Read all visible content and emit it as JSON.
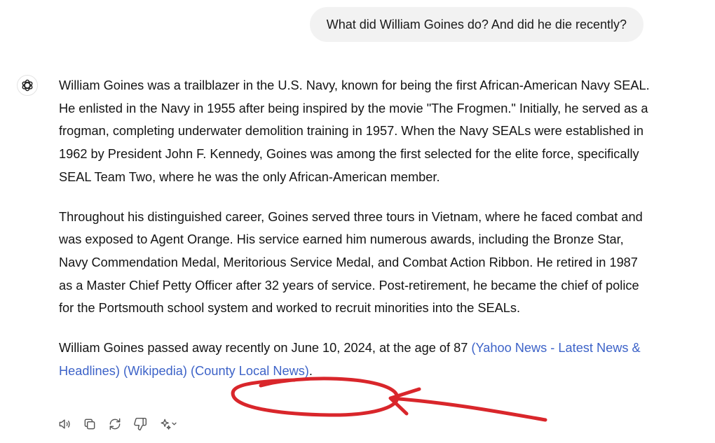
{
  "user_message": {
    "text": "What did William Goines do? And did he die recently?"
  },
  "assistant": {
    "logo_icon": "chatgpt-logo-icon",
    "paragraph1": "William Goines was a trailblazer in the U.S. Navy, known for being the first African-American Navy SEAL. He enlisted in the Navy in 1955 after being inspired by the movie \"The Frogmen.\" Initially, he served as a frogman, completing underwater demolition training in 1957. When the Navy SEALs were established in 1962 by President John F. Kennedy, Goines was among the first selected for the elite force, specifically SEAL Team Two, where he was the only African-American member.",
    "paragraph2": "Throughout his distinguished career, Goines served three tours in Vietnam, where he faced combat and was exposed to Agent Orange. His service earned him numerous awards, including the Bronze Star, Navy Commendation Medal, Meritorious Service Medal, and Combat Action Ribbon. He retired in 1987 as a Master Chief Petty Officer after 32 years of service. Post-retirement, he became the chief of police for the Portsmouth school system and worked to recruit minorities into the SEALs.",
    "paragraph3": {
      "text": "William Goines passed away recently on June 10, 2024, at the age of 87 ",
      "source1": "(Yahoo News - Latest News & Headlines)",
      "source2": "(Wikipedia)",
      "source3": "(County Local News)",
      "end": "."
    }
  },
  "actions": [
    {
      "icon": "read-aloud-icon"
    },
    {
      "icon": "copy-icon"
    },
    {
      "icon": "regenerate-icon"
    },
    {
      "icon": "thumbs-down-icon"
    },
    {
      "icon": "sparkle-model-icon"
    }
  ],
  "colors": {
    "link": "#3d63c8",
    "annotation": "#d9262b",
    "bubble": "#f2f2f2"
  }
}
